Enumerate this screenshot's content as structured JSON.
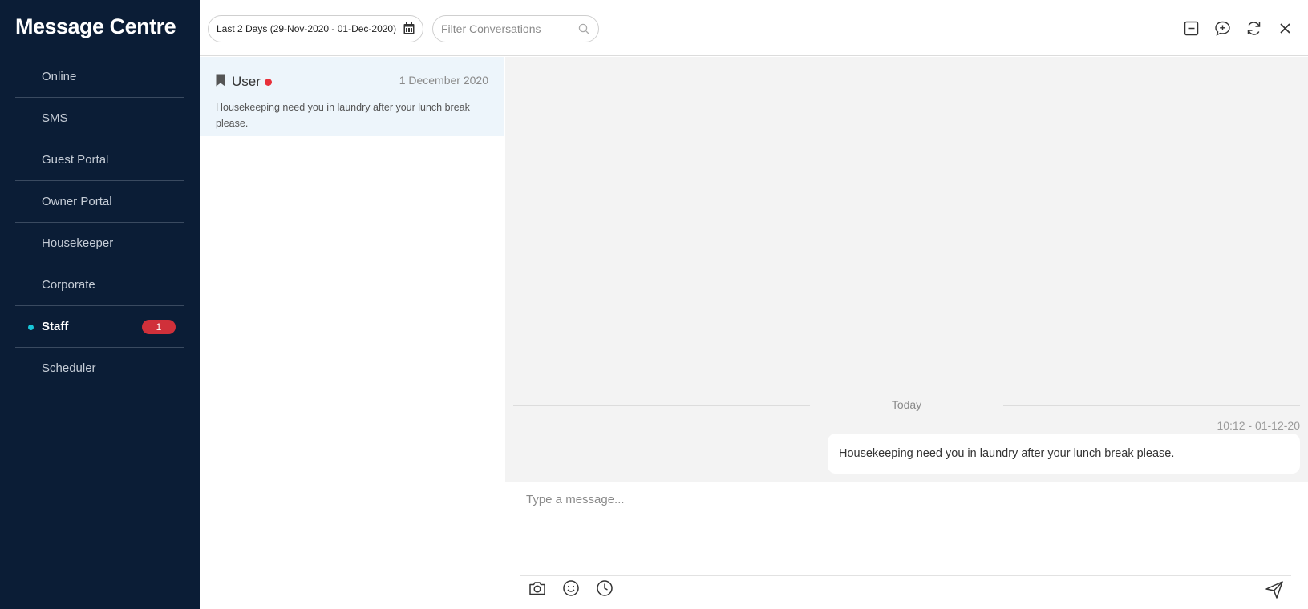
{
  "app": {
    "title": "Message Centre"
  },
  "sidebar": {
    "items": [
      {
        "label": "Online"
      },
      {
        "label": "SMS"
      },
      {
        "label": "Guest Portal"
      },
      {
        "label": "Owner Portal"
      },
      {
        "label": "Housekeeper"
      },
      {
        "label": "Corporate"
      },
      {
        "label": "Staff",
        "active": true,
        "badge": "1"
      },
      {
        "label": "Scheduler"
      }
    ]
  },
  "toolbar": {
    "date_range": "Last 2 Days (29-Nov-2020 - 01-Dec-2020)",
    "filter_placeholder": "Filter Conversations",
    "icons": [
      "minimize-icon",
      "new-chat-icon",
      "refresh-icon",
      "close-icon"
    ]
  },
  "conversations": [
    {
      "name": "User",
      "date": "1 December 2020",
      "preview": "Housekeeping need you in laundry after your lunch break please."
    }
  ],
  "chat": {
    "day_label": "Today",
    "messages": [
      {
        "time": "10:12 - 01-12-20",
        "text": "Housekeeping need you in laundry after your lunch break please."
      }
    ]
  },
  "composer": {
    "placeholder": "Type a message...",
    "tools": [
      "camera-icon",
      "emoji-icon",
      "clock-icon"
    ],
    "send": "send-icon"
  },
  "colors": {
    "sidebar_bg": "#0b1d36",
    "active_dot": "#18c6d8",
    "badge": "#d0303a",
    "unread_dot": "#e8303a",
    "selected_conversation": "#edf5fb",
    "chat_bg": "#f3f3f3"
  }
}
